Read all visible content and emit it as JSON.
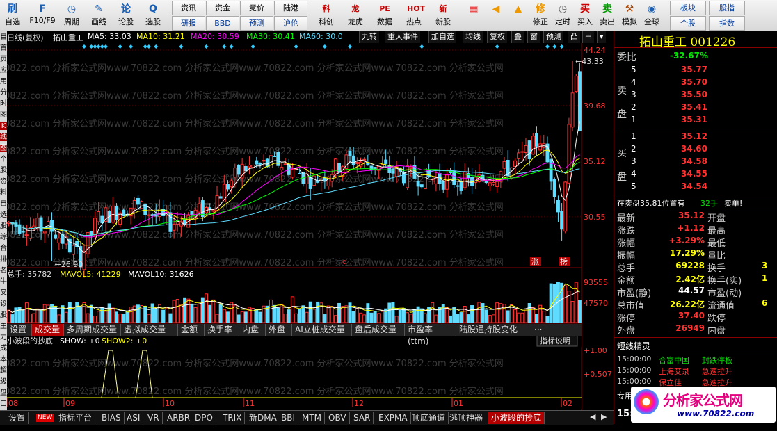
{
  "toolbar": {
    "buttons": [
      {
        "icon": "刷",
        "label": "自选"
      },
      {
        "icon": "F",
        "label": "F10/F9"
      },
      {
        "icon": "◷",
        "label": "周期"
      },
      {
        "icon": "✎",
        "label": "画线"
      },
      {
        "icon": "论",
        "label": "论股"
      },
      {
        "icon": "Q",
        "label": "选股"
      }
    ],
    "grid": [
      [
        "资讯",
        "资金",
        "竞价",
        "陆港"
      ],
      [
        "研报",
        "BBD",
        "预测",
        "沪伦"
      ]
    ],
    "buttons2": [
      {
        "icon": "科",
        "label": "科创"
      },
      {
        "icon": "龙",
        "label": "龙虎"
      },
      {
        "icon": "PE",
        "label": "数据"
      },
      {
        "icon": "HOT",
        "label": "热点"
      },
      {
        "icon": "新",
        "label": "新股"
      }
    ],
    "buttons3": [
      {
        "icon": "▦",
        "label": ""
      },
      {
        "icon": "◀",
        "label": ""
      },
      {
        "icon": "▲",
        "label": ""
      },
      {
        "icon": "修",
        "label": "修正"
      },
      {
        "icon": "◷",
        "label": "定时"
      },
      {
        "icon": "买",
        "label": "买入"
      },
      {
        "icon": "卖",
        "label": "卖出"
      },
      {
        "icon": "⚒",
        "label": "模拟"
      },
      {
        "icon": "◉",
        "label": "全球"
      }
    ],
    "grid2": [
      [
        "板块",
        "股指"
      ],
      [
        "个股",
        "指数"
      ]
    ]
  },
  "leftstrip": [
    "自",
    "首",
    "页",
    "应",
    "用",
    "分",
    "时",
    "图",
    "K",
    "线",
    "图",
    "个",
    "股",
    "资",
    "料",
    "自",
    "选",
    "股",
    "综",
    "合",
    "排",
    "名",
    "牛",
    "叉",
    "诊",
    "股",
    "主",
    "力",
    "成",
    "本",
    "超",
    "级",
    "盘",
    "口"
  ],
  "chart": {
    "header": {
      "period": "日线(复权)",
      "name": "拓山重工",
      "ma5": "MA5: 33.03",
      "ma10": "MA10: 31.21",
      "ma20": "MA20: 30.59",
      "ma30": "MA30: 30.41",
      "ma60": "MA60: 30.0"
    },
    "header_buttons": [
      "九转",
      "重大事件",
      "加自选",
      "均线",
      "复权",
      "叠",
      "窗",
      "预测",
      "凸",
      "⊣",
      "▾"
    ],
    "price_axis": [
      "44.24",
      "39.68",
      "35.12",
      "30.55"
    ],
    "high_label": "43.33",
    "low_label": "26.90",
    "markers": [
      "q",
      "涨",
      "榜"
    ],
    "vol_header": {
      "total": "总手: 35782",
      "mavol5": "MAVOL5: 41229",
      "mavol10": "MAVOL10: 31626"
    },
    "vol_axis": [
      "93555",
      "47570"
    ],
    "tabs": [
      "设置",
      "成交量",
      "多周期成交量",
      "虚拟成交量",
      "金额",
      "换手率",
      "内盘",
      "外盘",
      "AI立桩成交量",
      "盘后成交量",
      "市盈率(ttm)",
      "陆股通持股变化",
      "···"
    ],
    "ind_header": {
      "name": "小波段的抄底",
      "show": "SHOW: +0",
      "show2": "SHOW2: +0",
      "explain": "指标说明"
    },
    "ind_axis": [
      "+1.00",
      "+0.507"
    ],
    "months": [
      "08",
      "09",
      "10",
      "11",
      "12",
      "01",
      "02"
    ],
    "watermark": "0822.com 分析家公式网www.70822.com 分析家公式网www.70822.com 分析家公式网www.70822.com 分析家公式网"
  },
  "bottom_tabs": [
    "设置",
    "指标平台",
    "BIAS",
    "ASI",
    "VR",
    "ARBR",
    "DPO",
    "TRIX",
    "新DMA",
    "BBI",
    "MTM",
    "OBV",
    "SAR",
    "EXPMA",
    "顶底通道",
    "逃顶神器",
    "小波段的抄底"
  ],
  "new_badge": "NEW",
  "quote": {
    "title": "拓山重工 001226",
    "weibi_label": "委比",
    "weibi_value": "-32.67%",
    "sell_label": "卖盘",
    "buy_label": "买盘",
    "sell": [
      {
        "level": "5",
        "price": "35.77"
      },
      {
        "level": "4",
        "price": "35.70"
      },
      {
        "level": "3",
        "price": "35.50"
      },
      {
        "level": "2",
        "price": "35.41"
      },
      {
        "level": "1",
        "price": "35.31"
      }
    ],
    "buy": [
      {
        "level": "1",
        "price": "35.12"
      },
      {
        "level": "2",
        "price": "34.60"
      },
      {
        "level": "3",
        "price": "34.58"
      },
      {
        "level": "4",
        "price": "34.55"
      },
      {
        "level": "5",
        "price": "34.54"
      }
    ],
    "position": {
      "text": "在卖盘35.81位置有",
      "qty": "32手",
      "tag": "卖单!"
    },
    "stats": [
      {
        "l": "最新",
        "v": "35.12",
        "l2": "开盘",
        "c": "red"
      },
      {
        "l": "涨跌",
        "v": "+1.12",
        "l2": "最高",
        "c": "red"
      },
      {
        "l": "涨幅",
        "v": "+3.29%",
        "l2": "最低",
        "c": "red"
      },
      {
        "l": "振幅",
        "v": "17.29%",
        "l2": "量比",
        "c": "yellow"
      },
      {
        "l": "总手",
        "v": "69228",
        "l2": "换手",
        "c": "yellow"
      },
      {
        "l": "金额",
        "v": "2.42亿",
        "l2": "换手(实)",
        "c": "yellow"
      },
      {
        "l": "市盈(静)",
        "v": "44.57",
        "l2": "市盈(动)",
        "c": "white"
      },
      {
        "l": "总市值",
        "v": "26.22亿",
        "l2": "流通值",
        "c": "yellow"
      },
      {
        "l": "涨停",
        "v": "37.40",
        "l2": "跌停",
        "c": "red"
      },
      {
        "l": "外盘",
        "v": "26949",
        "l2": "内盘",
        "c": "red"
      }
    ],
    "stat_right_partial": [
      "3",
      "1",
      "6"
    ],
    "sprite_title": "短线精灵",
    "sprite": [
      {
        "t": "15:00:00",
        "n": "合富中国",
        "e": "封跌停板",
        "c": "green"
      },
      {
        "t": "15:00:00",
        "n": "上海艾录",
        "e": "急速拉升",
        "c": "red"
      },
      {
        "t": "15:00:00",
        "n": "保立佳",
        "e": "急速拉升",
        "c": "red"
      }
    ],
    "bottom_label": "专用",
    "time_partial": "15:",
    "logo_text": "分析家公式网",
    "logo_url": "www.70822.com"
  }
}
